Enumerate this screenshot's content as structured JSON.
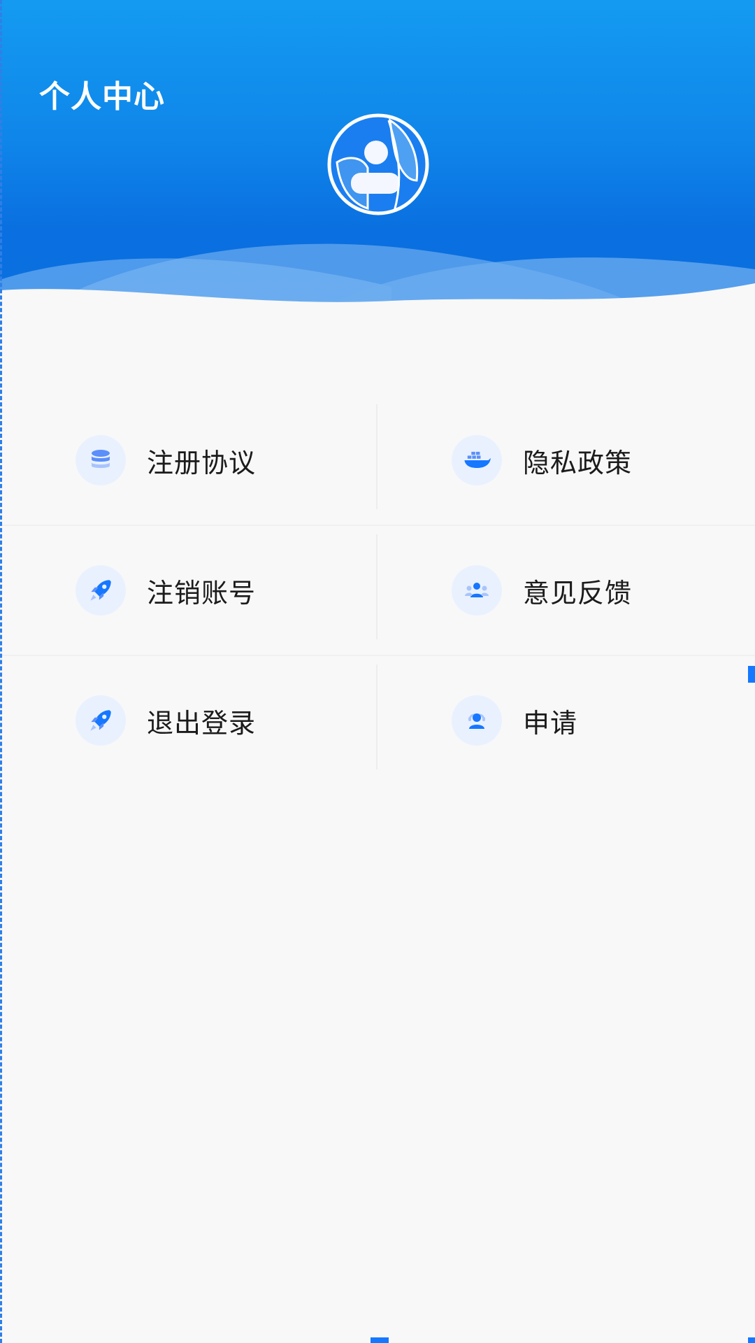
{
  "header": {
    "title": "个人中心",
    "avatar_icon": "avatar-logo-icon"
  },
  "colors": {
    "header_top": "#149bf1",
    "header_bottom": "#0b70df",
    "accent": "#1677ff",
    "icon_bg": "#e9f1ff",
    "page_bg": "#f8f8f8"
  },
  "menu": {
    "items": [
      {
        "label": "注册协议",
        "icon": "database-icon"
      },
      {
        "label": "隐私政策",
        "icon": "docker-whale-icon"
      },
      {
        "label": "注销账号",
        "icon": "rocket-icon"
      },
      {
        "label": "意见反馈",
        "icon": "users-group-icon"
      },
      {
        "label": "退出登录",
        "icon": "rocket-icon"
      },
      {
        "label": "申请",
        "icon": "user-support-icon"
      }
    ]
  }
}
